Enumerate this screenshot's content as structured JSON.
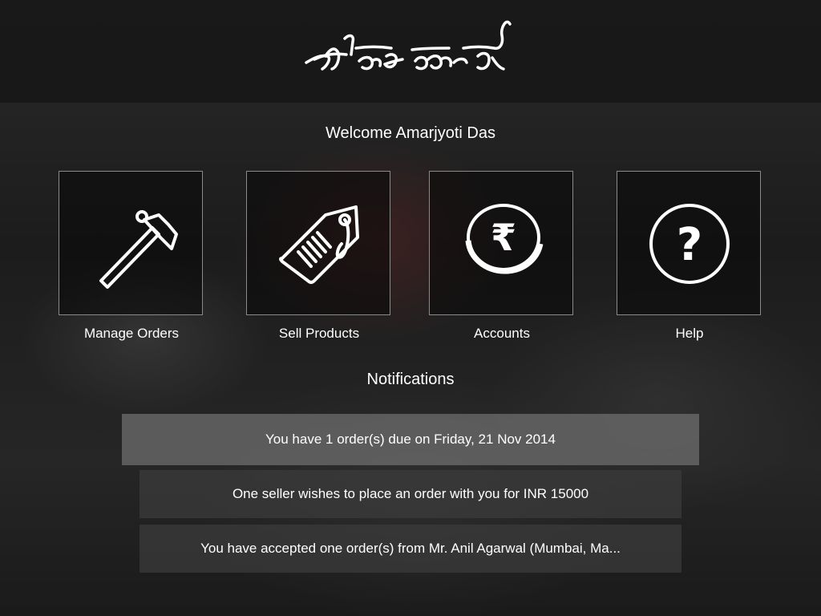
{
  "header": {
    "logo_text": "কাঁহিৰ শিল্পী"
  },
  "welcome": "Welcome Amarjyoti Das",
  "tiles": [
    {
      "label": "Manage Orders",
      "icon": "hammer-icon"
    },
    {
      "label": "Sell Products",
      "icon": "price-tag-icon"
    },
    {
      "label": "Accounts",
      "icon": "rupee-icon"
    },
    {
      "label": "Help",
      "icon": "help-icon"
    }
  ],
  "notifications_title": "Notifications",
  "notifications": [
    {
      "text": "You have 1 order(s) due on Friday, 21 Nov 2014"
    },
    {
      "text": "One seller wishes to place an order with you for INR 15000"
    },
    {
      "text": "You have accepted one order(s) from Mr. Anil Agarwal (Mumbai, Ma..."
    }
  ],
  "help_symbol": "?",
  "rupee_symbol": "₹",
  "colors": {
    "background": "#1e1e1e",
    "tile_border": "#8a8a8a",
    "highlight_notification": "#6e6e6e",
    "text": "#ffffff"
  }
}
